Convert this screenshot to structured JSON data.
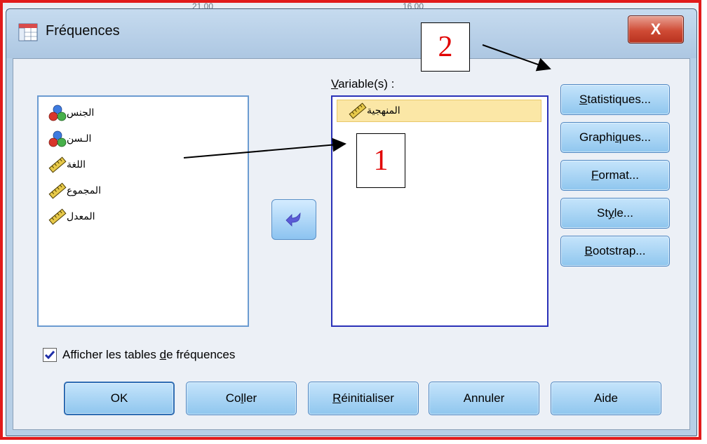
{
  "window": {
    "title": "Fréquences",
    "close_label": "X"
  },
  "background": {
    "text_left": "21.00",
    "text_right": "16.00"
  },
  "source_list": {
    "items": [
      {
        "label": "الجنس",
        "icon": "nominal-variable-icon"
      },
      {
        "label": "الـسن",
        "icon": "nominal-variable-icon"
      },
      {
        "label": "اللغة",
        "icon": "scale-variable-icon"
      },
      {
        "label": "المجموع",
        "icon": "scale-variable-icon"
      },
      {
        "label": "المعدل",
        "icon": "scale-variable-icon"
      }
    ]
  },
  "target": {
    "label_first": "V",
    "label_rest": "ariable(s) :",
    "items": [
      {
        "label": "المنهجية",
        "icon": "scale-variable-icon",
        "selected": true
      }
    ]
  },
  "side_buttons": [
    {
      "pre": "",
      "u": "S",
      "post": "tatistiques..."
    },
    {
      "pre": "Graphi",
      "u": "q",
      "post": "ues..."
    },
    {
      "pre": "",
      "u": "F",
      "post": "ormat..."
    },
    {
      "pre": "St",
      "u": "y",
      "post": "le..."
    },
    {
      "pre": "",
      "u": "B",
      "post": "ootstrap..."
    }
  ],
  "checkbox": {
    "checked": true,
    "pre": "Afficher les tables ",
    "u": "d",
    "post": "e fréquences"
  },
  "bottom_buttons": [
    {
      "pre": "OK",
      "u": "",
      "post": ""
    },
    {
      "pre": "Co",
      "u": "l",
      "post": "ler"
    },
    {
      "pre": "",
      "u": "R",
      "post": "éinitialiser"
    },
    {
      "pre": "Annuler",
      "u": "",
      "post": ""
    },
    {
      "pre": "Aide",
      "u": "",
      "post": ""
    }
  ],
  "callouts": {
    "one": "1",
    "two": "2"
  },
  "colors": {
    "highlight_frame": "#e11b1b",
    "callout_text": "#e10000",
    "selection": "#fbe7a6"
  }
}
